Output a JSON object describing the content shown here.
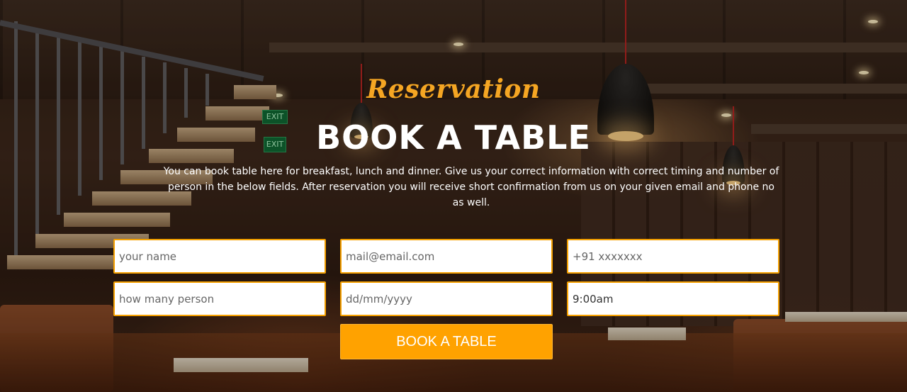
{
  "reservation": {
    "script_title": "Reservation",
    "title": "BOOK A TABLE",
    "description": "You can book table here for breakfast, lunch and dinner. Give us your correct information with correct timing and number of person in the below fields. After reservation you will receive short confirmation from us on your given email and phone no as well."
  },
  "form": {
    "name_placeholder": "your name",
    "email_placeholder": "mail@email.com",
    "phone_placeholder": "+91 xxxxxxx",
    "persons_placeholder": "how many person",
    "date_placeholder": "dd/mm/yyyy",
    "time_value": "9:00am",
    "submit_label": "BOOK A TABLE"
  },
  "background": {
    "sign_text": "EXIT"
  },
  "colors": {
    "accent": "#ffa200",
    "field_border": "#f5a000",
    "title_script": "#f5a623"
  }
}
